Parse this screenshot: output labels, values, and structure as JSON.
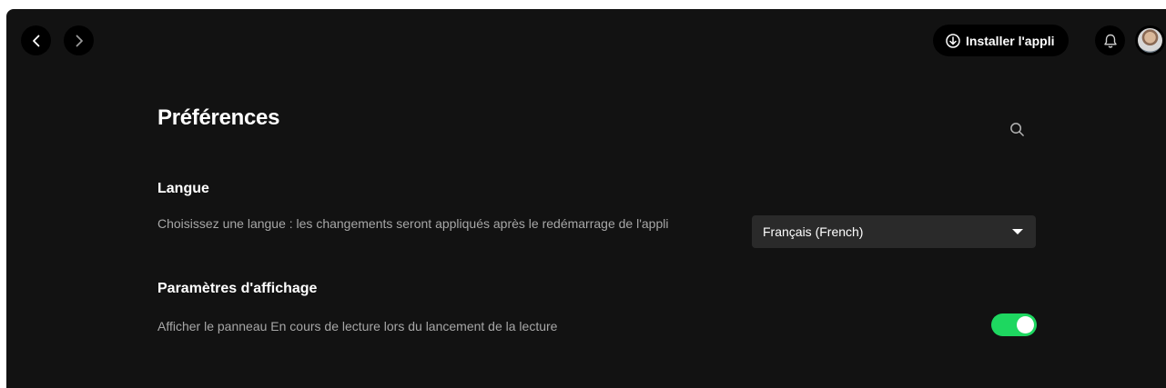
{
  "topbar": {
    "install_label": "Installer l'appli"
  },
  "page": {
    "title": "Préférences"
  },
  "language": {
    "title": "Langue",
    "description": "Choisissez une langue : les changements seront appliqués après le redémarrage de l'appli",
    "selected": "Français (French)"
  },
  "display": {
    "title": "Paramètres d'affichage",
    "description": "Afficher le panneau En cours de lecture lors du lancement de la lecture",
    "toggle_on": true
  },
  "colors": {
    "background": "#121212",
    "accent": "#1ed760",
    "secondary_text": "#a7a7a7",
    "select_bg": "#2a2a2a"
  },
  "icons": {
    "back": "chevron-left-icon",
    "forward": "chevron-right-icon",
    "install": "download-circle-icon",
    "notifications": "bell-icon",
    "search": "search-icon",
    "select": "caret-down-icon"
  }
}
